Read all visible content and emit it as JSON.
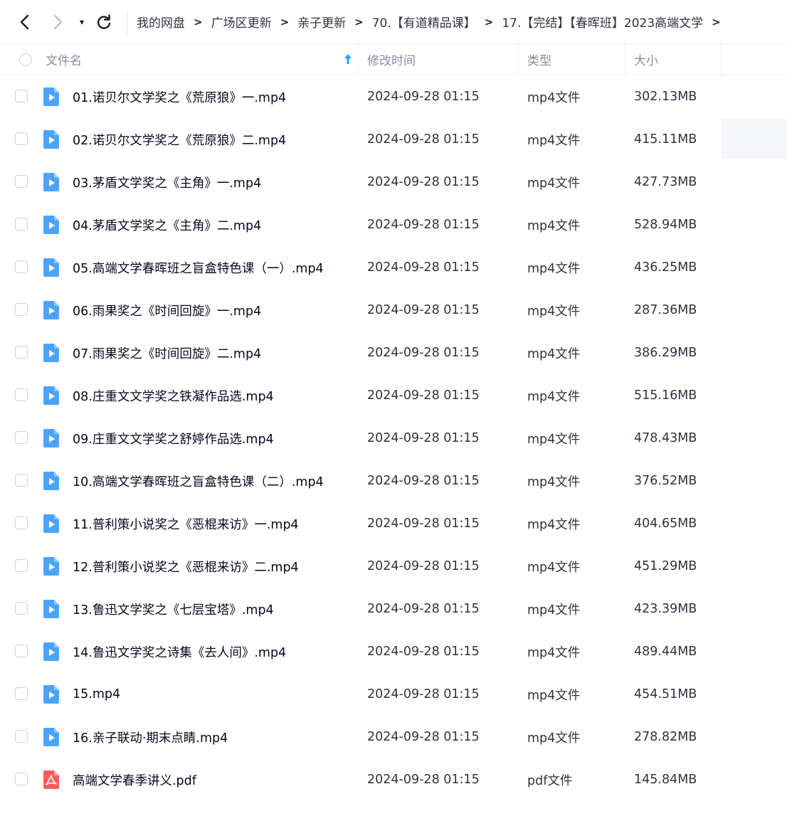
{
  "nav": {
    "back_icon": "chevron-left-icon",
    "forward_icon": "chevron-right-icon",
    "history_icon": "caret-down-icon",
    "refresh_icon": "refresh-icon",
    "dropdown_glyph": "▾"
  },
  "breadcrumb": [
    {
      "label": "我的网盘"
    },
    {
      "label": "广场区更新"
    },
    {
      "label": "亲子更新"
    },
    {
      "label": "70.【有道精品课】"
    },
    {
      "label": "17.【完结】【春晖班】2023高端文学"
    }
  ],
  "breadcrumb_separator": ">",
  "table": {
    "headers": {
      "name": "文件名",
      "modified": "修改时间",
      "type": "类型",
      "size": "大小"
    },
    "sort_icon": "sort-ascending-arrow-icon",
    "colors": {
      "video_icon": "#4aa3ff",
      "pdf_icon": "#ff5b5b",
      "sort_arrow": "#2a9bff"
    },
    "rows": [
      {
        "name": "01.诺贝尔文学奖之《荒原狼》一.mp4",
        "modified": "2024-09-28 01:15",
        "type": "mp4文件",
        "size": "302.13MB",
        "icon": "video-file-icon"
      },
      {
        "name": "02.诺贝尔文学奖之《荒原狼》二.mp4",
        "modified": "2024-09-28 01:15",
        "type": "mp4文件",
        "size": "415.11MB",
        "icon": "video-file-icon"
      },
      {
        "name": "03.茅盾文学奖之《主角》一.mp4",
        "modified": "2024-09-28 01:15",
        "type": "mp4文件",
        "size": "427.73MB",
        "icon": "video-file-icon"
      },
      {
        "name": "04.茅盾文学奖之《主角》二.mp4",
        "modified": "2024-09-28 01:15",
        "type": "mp4文件",
        "size": "528.94MB",
        "icon": "video-file-icon"
      },
      {
        "name": "05.高端文学春晖班之盲盒特色课（一）.mp4",
        "modified": "2024-09-28 01:15",
        "type": "mp4文件",
        "size": "436.25MB",
        "icon": "video-file-icon"
      },
      {
        "name": "06.雨果奖之《时间回旋》一.mp4",
        "modified": "2024-09-28 01:15",
        "type": "mp4文件",
        "size": "287.36MB",
        "icon": "video-file-icon"
      },
      {
        "name": "07.雨果奖之《时间回旋》二.mp4",
        "modified": "2024-09-28 01:15",
        "type": "mp4文件",
        "size": "386.29MB",
        "icon": "video-file-icon"
      },
      {
        "name": "08.庄重文文学奖之铁凝作品选.mp4",
        "modified": "2024-09-28 01:15",
        "type": "mp4文件",
        "size": "515.16MB",
        "icon": "video-file-icon"
      },
      {
        "name": "09.庄重文文学奖之舒婷作品选.mp4",
        "modified": "2024-09-28 01:15",
        "type": "mp4文件",
        "size": "478.43MB",
        "icon": "video-file-icon"
      },
      {
        "name": "10.高端文学春晖班之盲盒特色课（二）.mp4",
        "modified": "2024-09-28 01:15",
        "type": "mp4文件",
        "size": "376.52MB",
        "icon": "video-file-icon"
      },
      {
        "name": "11.普利策小说奖之《恶棍来访》一.mp4",
        "modified": "2024-09-28 01:15",
        "type": "mp4文件",
        "size": "404.65MB",
        "icon": "video-file-icon"
      },
      {
        "name": "12.普利策小说奖之《恶棍来访》二.mp4",
        "modified": "2024-09-28 01:15",
        "type": "mp4文件",
        "size": "451.29MB",
        "icon": "video-file-icon"
      },
      {
        "name": "13.鲁迅文学奖之《七层宝塔》.mp4",
        "modified": "2024-09-28 01:15",
        "type": "mp4文件",
        "size": "423.39MB",
        "icon": "video-file-icon"
      },
      {
        "name": "14.鲁迅文学奖之诗集《去人间》.mp4",
        "modified": "2024-09-28 01:15",
        "type": "mp4文件",
        "size": "489.44MB",
        "icon": "video-file-icon"
      },
      {
        "name": "15.mp4",
        "modified": "2024-09-28 01:15",
        "type": "mp4文件",
        "size": "454.51MB",
        "icon": "video-file-icon"
      },
      {
        "name": "16.亲子联动·期末点睛.mp4",
        "modified": "2024-09-28 01:15",
        "type": "mp4文件",
        "size": "278.82MB",
        "icon": "video-file-icon"
      },
      {
        "name": "高端文学春季讲义.pdf",
        "modified": "2024-09-28 01:15",
        "type": "pdf文件",
        "size": "145.84MB",
        "icon": "pdf-file-icon"
      }
    ]
  }
}
